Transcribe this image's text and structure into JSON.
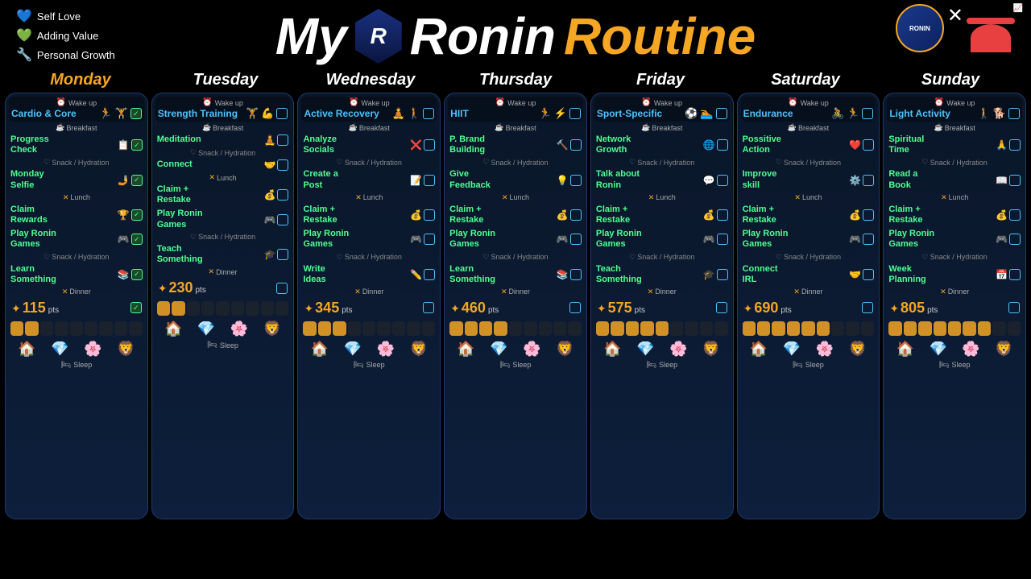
{
  "legend": [
    {
      "icon": "💙",
      "label": "Self Love"
    },
    {
      "icon": "💚",
      "label": "Adding Value"
    },
    {
      "icon": "🔧",
      "label": "Personal Growth"
    }
  ],
  "title": {
    "my": "My",
    "ronin": "Ronin",
    "routine": "Routine",
    "badge": "R"
  },
  "days": [
    {
      "name": "Monday",
      "wake": "Cardio & Core",
      "wakeIcons": "🏃🏋️",
      "checked": true,
      "breakfast": "Breakfast",
      "activity1": "Progress\nCheck",
      "activity1Icon": "📋",
      "activity1Green": true,
      "activity1Checked": true,
      "snack1": "Snack / Hydration",
      "activity2": "Monday\nSelfie",
      "activity2Icon": "🤳",
      "activity2Green": true,
      "activity2Checked": true,
      "lunch": "Lunch",
      "activity3": "Claim\nRewards",
      "activity3Icon": "🏆",
      "activity3Green": true,
      "activity3Checked": true,
      "activity4": "Play Ronin\nGames",
      "activity4Icon": "🎮",
      "activity4Green": true,
      "activity4Checked": true,
      "snack2": "Snack / Hydration",
      "activity5": "Learn\nSomething",
      "activity5Icon": "📚",
      "activity5Green": true,
      "activity5Checked": true,
      "dinner": "Dinner",
      "points": "115",
      "pointsChecked": true,
      "bars": [
        1,
        1,
        0,
        0,
        0,
        0,
        0,
        0,
        0
      ],
      "sleep": "Sleep"
    },
    {
      "name": "Tuesday",
      "wake": "Strength Training",
      "wakeIcons": "🏋️💪",
      "checked": false,
      "breakfast": "Breakfast",
      "activity1": "Meditation",
      "activity1Icon": "🧘",
      "activity1Green": true,
      "activity1Checked": false,
      "snack1": "Snack / Hydration",
      "activity2": "Connect",
      "activity2Icon": "🤝",
      "activity2Green": true,
      "activity2Checked": false,
      "lunch": "Lunch",
      "activity3": "Claim +\nRestake",
      "activity3Icon": "💰",
      "activity3Green": true,
      "activity3Checked": false,
      "activity4": "Play Ronin\nGames",
      "activity4Icon": "🎮",
      "activity4Green": true,
      "activity4Checked": false,
      "snack2": "Snack / Hydration",
      "activity5": "Teach\nSomething",
      "activity5Icon": "🎓",
      "activity5Green": true,
      "activity5Checked": false,
      "dinner": "Dinner",
      "points": "230",
      "pointsChecked": false,
      "bars": [
        1,
        1,
        0,
        0,
        0,
        0,
        0,
        0,
        0
      ],
      "sleep": "Sleep"
    },
    {
      "name": "Wednesday",
      "wake": "Active Recovery",
      "wakeIcons": "🧘🚶",
      "checked": false,
      "breakfast": "Breakfast",
      "activity1": "Analyze\nSocials",
      "activity1Icon": "❌",
      "activity1Green": true,
      "activity1Checked": false,
      "snack1": "Snack / Hydration",
      "activity2": "Create a\nPost",
      "activity2Icon": "📝",
      "activity2Green": true,
      "activity2Checked": false,
      "lunch": "Lunch",
      "activity3": "Claim +\nRestake",
      "activity3Icon": "💰",
      "activity3Green": true,
      "activity3Checked": false,
      "activity4": "Play Ronin\nGames",
      "activity4Icon": "🎮",
      "activity4Green": true,
      "activity4Checked": false,
      "snack2": "Snack / Hydration",
      "activity5": "Write\nIdeas",
      "activity5Icon": "✏️",
      "activity5Green": true,
      "activity5Checked": false,
      "dinner": "Dinner",
      "points": "345",
      "pointsChecked": false,
      "bars": [
        1,
        1,
        1,
        0,
        0,
        0,
        0,
        0,
        0
      ],
      "sleep": "Sleep"
    },
    {
      "name": "Thursday",
      "wake": "HIIT",
      "wakeIcons": "🏃⚡",
      "checked": false,
      "breakfast": "Breakfast",
      "activity1": "P. Brand\nBuilding",
      "activity1Icon": "🔨",
      "activity1Green": true,
      "activity1Checked": false,
      "snack1": "Snack / Hydration",
      "activity2": "Give\nFeedback",
      "activity2Icon": "💡",
      "activity2Green": true,
      "activity2Checked": false,
      "lunch": "Lunch",
      "activity3": "Claim +\nRestake",
      "activity3Icon": "💰",
      "activity3Green": true,
      "activity3Checked": false,
      "activity4": "Play Ronin\nGames",
      "activity4Icon": "🎮",
      "activity4Green": true,
      "activity4Checked": false,
      "snack2": "Snack / Hydration",
      "activity5": "Learn\nSomething",
      "activity5Icon": "📚",
      "activity5Green": true,
      "activity5Checked": false,
      "dinner": "Dinner",
      "points": "460",
      "pointsChecked": false,
      "bars": [
        1,
        1,
        1,
        1,
        0,
        0,
        0,
        0,
        0
      ],
      "sleep": "Sleep"
    },
    {
      "name": "Friday",
      "wake": "Sport-Specific",
      "wakeIcons": "⚽🏊",
      "checked": false,
      "breakfast": "Breakfast",
      "activity1": "Network\nGrowth",
      "activity1Icon": "🌐",
      "activity1Green": true,
      "activity1Checked": false,
      "snack1": "Snack / Hydration",
      "activity2": "Talk about\nRonin",
      "activity2Icon": "💬",
      "activity2Green": true,
      "activity2Checked": false,
      "lunch": "Lunch",
      "activity3": "Claim +\nRestake",
      "activity3Icon": "💰",
      "activity3Green": true,
      "activity3Checked": false,
      "activity4": "Play Ronin\nGames",
      "activity4Icon": "🎮",
      "activity4Green": true,
      "activity4Checked": false,
      "snack2": "Snack / Hydration",
      "activity5": "Teach\nSomething",
      "activity5Icon": "🎓",
      "activity5Green": true,
      "activity5Checked": false,
      "dinner": "Dinner",
      "points": "575",
      "pointsChecked": false,
      "bars": [
        1,
        1,
        1,
        1,
        1,
        0,
        0,
        0,
        0
      ],
      "sleep": "Sleep"
    },
    {
      "name": "Saturday",
      "wake": "Endurance",
      "wakeIcons": "🚴🏃",
      "checked": false,
      "breakfast": "Breakfast",
      "activity1": "Possitive\nAction",
      "activity1Icon": "❤️",
      "activity1Green": true,
      "activity1Checked": false,
      "snack1": "Snack / Hydration",
      "activity2": "Improve\nskill",
      "activity2Icon": "⚙️",
      "activity2Green": true,
      "activity2Checked": false,
      "lunch": "Lunch",
      "activity3": "Claim +\nRestake",
      "activity3Icon": "💰",
      "activity3Green": true,
      "activity3Checked": false,
      "activity4": "Play Ronin\nGames",
      "activity4Icon": "🎮",
      "activity4Green": true,
      "activity4Checked": false,
      "snack2": "Snack / Hydration",
      "activity5": "Connect\nIRL",
      "activity5Icon": "🤝",
      "activity5Green": true,
      "activity5Checked": false,
      "dinner": "Dinner",
      "points": "690",
      "pointsChecked": false,
      "bars": [
        1,
        1,
        1,
        1,
        1,
        1,
        0,
        0,
        0
      ],
      "sleep": "Sleep"
    },
    {
      "name": "Sunday",
      "wake": "Light Activity",
      "wakeIcons": "🚶🐕",
      "checked": false,
      "breakfast": "Breakfast",
      "activity1": "Spiritual\nTime",
      "activity1Icon": "🙏",
      "activity1Green": true,
      "activity1Checked": false,
      "snack1": "Snack / Hydration",
      "activity2": "Read a\nBook",
      "activity2Icon": "📖",
      "activity2Green": true,
      "activity2Checked": false,
      "lunch": "Lunch",
      "activity3": "Claim +\nRestake",
      "activity3Icon": "💰",
      "activity3Green": true,
      "activity3Checked": false,
      "activity4": "Play Ronin\nGames",
      "activity4Icon": "🎮",
      "activity4Green": true,
      "activity4Checked": false,
      "snack2": "Snack / Hydration",
      "activity5": "Week\nPlanning",
      "activity5Icon": "📅",
      "activity5Green": true,
      "activity5Checked": false,
      "dinner": "Dinner",
      "points": "805",
      "pointsChecked": false,
      "bars": [
        1,
        1,
        1,
        1,
        1,
        1,
        1,
        0,
        0
      ],
      "sleep": "Sleep"
    }
  ]
}
